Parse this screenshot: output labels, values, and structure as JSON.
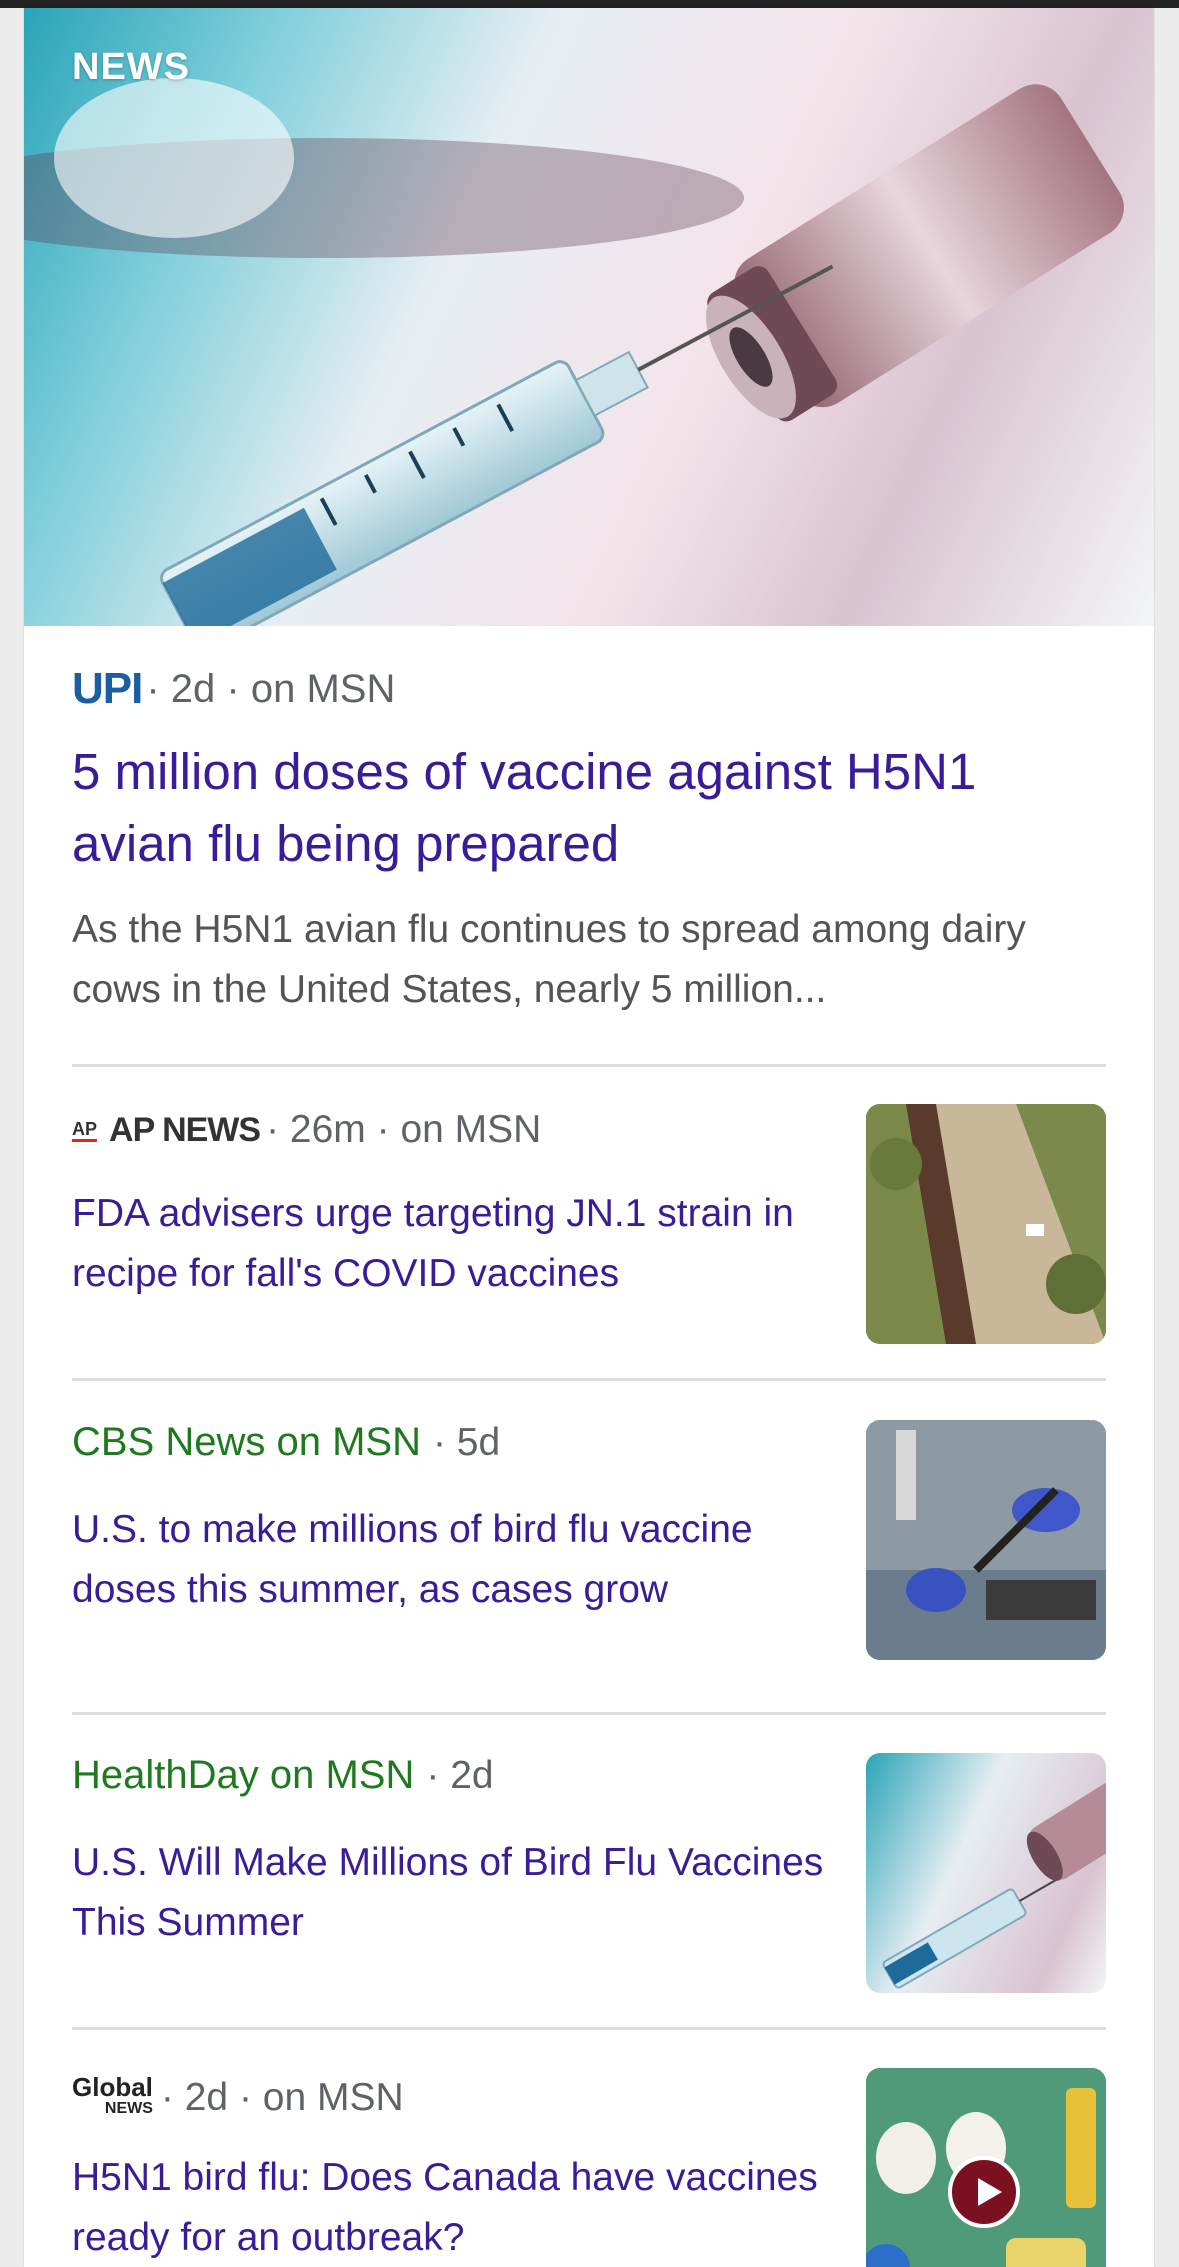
{
  "hero": {
    "label": "NEWS"
  },
  "main_article": {
    "source_logo": "UPI",
    "meta": "· 2d · on MSN",
    "title": "5 million doses of vaccine against H5N1 avian flu being prepared",
    "snippet": "As the H5N1 avian flu continues to spread among dairy cows in the United States, nearly 5 million..."
  },
  "articles": [
    {
      "source_logo_mini": "AP",
      "source_logo": "AP NEWS",
      "meta": "· 26m · on MSN",
      "title": "FDA advisers urge targeting JN.1 strain in recipe for fall's COVID vaccines"
    },
    {
      "source": "CBS News on MSN",
      "meta": "· 5d",
      "title": "U.S. to make millions of bird flu vaccine doses this summer, as cases grow"
    },
    {
      "source": "HealthDay on MSN",
      "meta": "· 2d",
      "title": "U.S. Will Make Millions of Bird Flu Vaccines This Summer"
    },
    {
      "source_logo_line1": "Global",
      "source_logo_line2": "NEWS",
      "meta": "· 2d · on MSN",
      "title": "H5N1 bird flu: Does Canada have vaccines ready for an outbreak?"
    }
  ]
}
